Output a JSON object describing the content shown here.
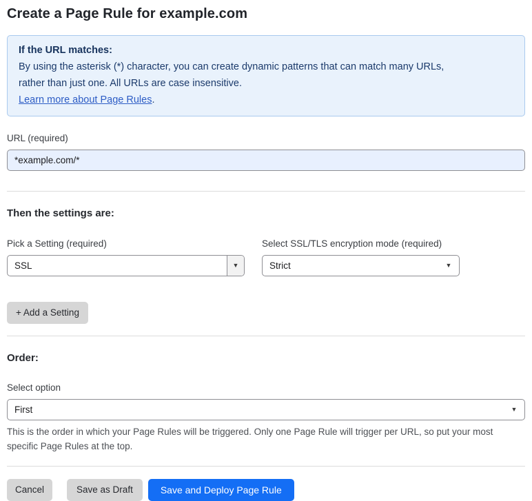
{
  "page": {
    "title": "Create a Page Rule for example.com"
  },
  "info_box": {
    "heading": "If the URL matches:",
    "body": "By using the asterisk (*) character, you can create dynamic patterns that can match many URLs, rather than just one. All URLs are case insensitive.",
    "link_label": "Learn more about Page Rules",
    "link_suffix": "."
  },
  "url_field": {
    "label": "URL (required)",
    "value": "*example.com/*"
  },
  "settings_section": {
    "heading": "Then the settings are:",
    "setting_picker": {
      "label": "Pick a Setting (required)",
      "value": "SSL"
    },
    "ssl_mode": {
      "label": "Select SSL/TLS encryption mode (required)",
      "value": "Strict"
    },
    "add_setting_label": "+ Add a Setting"
  },
  "order_section": {
    "heading": "Order:",
    "select_label": "Select option",
    "value": "First",
    "helper_text": "This is the order in which your Page Rules will be triggered. Only one Page Rule will trigger per URL, so put your most specific Page Rules at the top."
  },
  "actions": {
    "cancel": "Cancel",
    "save_draft": "Save as Draft",
    "save_deploy": "Save and Deploy Page Rule"
  },
  "icons": {
    "dropdown_arrow": "▼"
  },
  "colors": {
    "primary_blue": "#146ef5",
    "info_bg": "#e9f2fc",
    "info_border": "#a9c9ee",
    "info_text": "#1b3a6b",
    "link_blue": "#2c5cc5",
    "input_autofill_bg": "#e8f0fe",
    "button_gray": "#d6d6d6"
  }
}
